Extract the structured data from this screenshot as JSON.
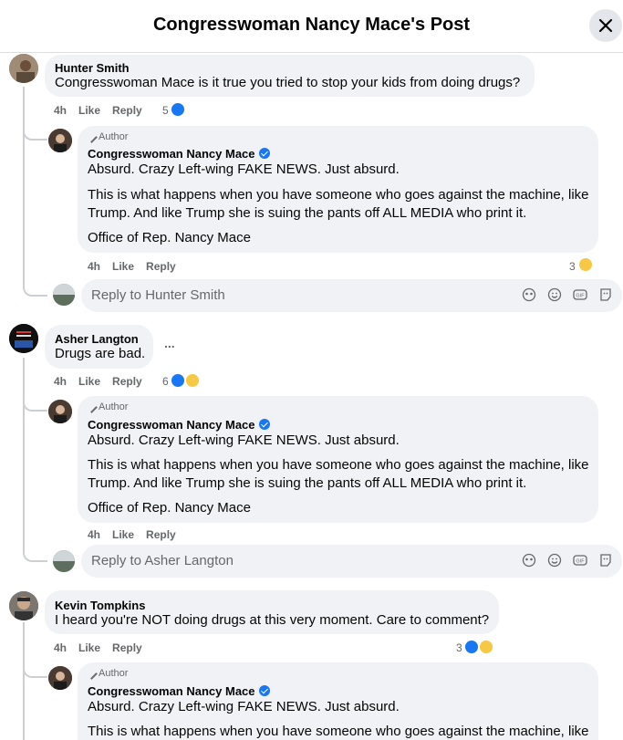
{
  "header": {
    "title": "Congresswoman Nancy Mace's Post"
  },
  "author_label": "Author",
  "comments": [
    {
      "name": "Hunter Smith",
      "text": "Congresswoman Mace is it true you tried to stop your kids from doing drugs?",
      "time": "4h",
      "like": "Like",
      "reply": "Reply",
      "reactions": "5",
      "reply_reaction_count": "3",
      "reply_placeholder": "Reply to Hunter Smith"
    },
    {
      "name": "Asher Langton",
      "text": "Drugs are bad.",
      "more": "...",
      "time": "4h",
      "like": "Like",
      "reply": "Reply",
      "reactions": "6",
      "reply_placeholder": "Reply to Asher Langton"
    },
    {
      "name": "Kevin Tompkins",
      "text": "I heard you're NOT doing drugs at this very moment. Care to comment?",
      "time": "4h",
      "like": "Like",
      "reply": "Reply",
      "reactions": "3"
    }
  ],
  "author_reply": {
    "name": "Congresswoman Nancy Mace",
    "p1": "Absurd. Crazy Left-wing FAKE NEWS. Just absurd.",
    "p2_line1": "This is what happens when you have someone who goes against the machine, like",
    "p2_line2": "Trump. And like Trump she is suing the pants off ALL MEDIA who print it.",
    "p3": "Office of Rep. Nancy Mace",
    "time": "4h",
    "like": "Like",
    "reply": "Reply"
  },
  "colors": {
    "like_blue": "#1877f2",
    "muted": "#65676b",
    "bubble": "#f0f2f5"
  }
}
